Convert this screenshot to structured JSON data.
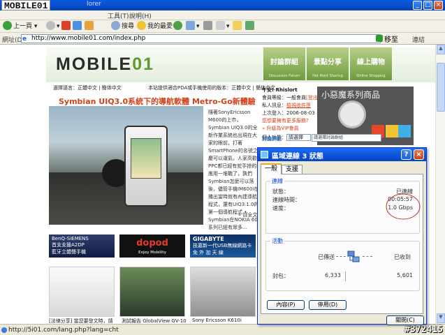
{
  "browser": {
    "site_brand": "MOBILE01",
    "title_partial": "lorer",
    "menu": [
      "工具(T)",
      "說明(H)"
    ],
    "toolbar": {
      "back": "上一頁",
      "search": "搜尋",
      "favorites": "我的最愛"
    },
    "address": {
      "label": "網址(D)",
      "url": "http://www.mobile01.com/index.php",
      "go": "移至",
      "links": "連結"
    },
    "status_url": "http://5i01.com/lang.php?lang=cht",
    "watermark": "#372415"
  },
  "page": {
    "logo_text": "MOBILE",
    "logo_suffix": "01",
    "nav": [
      {
        "label": "討論群組",
        "sub": "Discussion Forum"
      },
      {
        "label": "景點分享",
        "sub": "Hot Point Sharing"
      },
      {
        "label": "線上購物",
        "sub": "Online Shopping"
      }
    ],
    "lang_line": "選擇語言：正體中文 | 簡体中文",
    "notice_line": "本站提供適合PDA或手機使用的版本：正體中文 | 簡体中文",
    "headline": "Symbian UIQ3.0系統下的導航軟體 Metro-Go新體驗",
    "feature_text": "隨著SonyEricsson M600的上市，Symbian UIQ3.0的全新作業系統也出現在大家的眼前，打著SmartPhone的名號之慶可以運氣，人家高歡PPC都已經有蛇手掠的應用一堆戰了，孰們Symbian怎麼可以落後，儘管手機IM600i在播出當時就有內建導航程式，還有UIQ3.1.0的第一個導航程式 • Symbian在NOKIA 60系列已經有眾多…",
    "more": "» 詳全文",
    "login": {
      "greeting": "午安! Rhislort",
      "level": "會員等級：一般會員",
      "logout": "[登出]",
      "pm_label": "私人訊息：",
      "pm_link": "檢視收件匣",
      "last_login": "上次登入：2006-08-03",
      "upgrade_q": "您想要擁有更多服務?",
      "upgrade_link": "» 升級為VIP會員",
      "personal_fn": "個人功能：",
      "personal_fn_value": "請選擇",
      "forum_label": "討論群組",
      "forum_select": "請選擇討論群組"
    },
    "promo_title": "小惡魔系列商品",
    "ads": {
      "benq": {
        "line1": "BenQ-SIEMENS",
        "line2": "首支支援A2DP",
        "line3": "藍牙立體聲手機"
      },
      "dopod": {
        "brand": "dopod",
        "tagline": "Enjoy Mobility"
      },
      "giga": {
        "brand": "GIGABYTE",
        "line1": "技嘉新一代USB無線網路卡",
        "line2": "免 外 加 天 線"
      }
    },
    "thumbs": [
      "[法律分享] 當您要發文時，請",
      "測試報告 GlobalView GV-10",
      "Sony Ericsson K610i"
    ]
  },
  "dialog": {
    "title": "區域連線 3 狀態",
    "tabs": [
      "一般",
      "支援"
    ],
    "connection": {
      "group": "連線",
      "status_label": "狀態：",
      "status_value": "已連線",
      "duration_label": "連線時間：",
      "duration_value": "00:05:57",
      "speed_label": "速度：",
      "speed_value": "1.0 Gbps"
    },
    "activity": {
      "group": "活動",
      "sent_label": "已傳送",
      "received_label": "已收到",
      "packets_label": "封包：",
      "sent_value": "6,333",
      "received_value": "5,601"
    },
    "buttons": {
      "properties": "內容(P)",
      "disable": "停用(D)",
      "close": "關閉(C)"
    }
  },
  "colors": {
    "headline": "#d2411b",
    "nav_green": "#6f9a3c",
    "xp_title_blue": "#0c56dc",
    "annotation_ellipse": "#c0392b"
  }
}
